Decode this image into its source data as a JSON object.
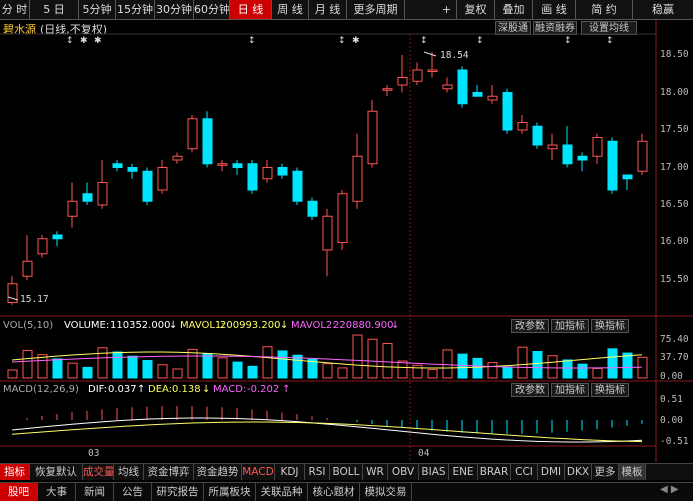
{
  "toolbar": {
    "left": [
      "分 时",
      "5 日",
      "5分钟",
      "15分钟",
      "30分钟",
      "60分钟",
      "日 线",
      "周 线",
      "月 线",
      "更多周期"
    ],
    "active_index": 6,
    "right": [
      "+",
      "复权",
      "叠加",
      "画 线",
      "简 约",
      "稳赢"
    ]
  },
  "header": {
    "stock_name": "碧水源",
    "mode": "(日线,不复权)",
    "tabs": [
      "深股通",
      "融资融券",
      "设置均线"
    ]
  },
  "price_axis": [
    "18.50",
    "18.00",
    "17.50",
    "17.00",
    "16.50",
    "16.00",
    "15.50"
  ],
  "annotations": {
    "high": "18.54",
    "low": "15.17"
  },
  "volume_panel": {
    "label": "VOL(5,10)",
    "volume_label": "VOLUME:",
    "volume": "110352.000",
    "mavol1_label": "MAVOL1:",
    "mavol1": "200993.200",
    "mavol2_label": "MAVOL2:",
    "mavol2": "220880.900",
    "buttons": [
      "改参数",
      "加指标",
      "换指标"
    ],
    "axis": [
      "75.40",
      "37.70",
      "0.00"
    ]
  },
  "macd_panel": {
    "label": "MACD(12,26,9)",
    "dif_label": "DIF:",
    "dif": "0.037",
    "dea_label": "DEA:",
    "dea": "0.138",
    "macd_label": "MACD:",
    "macd": "-0.202",
    "buttons": [
      "改参数",
      "加指标",
      "换指标"
    ],
    "axis": [
      "0.51",
      "0.00",
      "-0.51"
    ],
    "x_labels": [
      "03",
      "04"
    ]
  },
  "indicator_tabs": [
    "指标",
    "恢复默认",
    "成交量",
    "均线",
    "资金博弈",
    "资金趋势",
    "MACD",
    "KDJ",
    "RSI",
    "BOLL",
    "WR",
    "OBV",
    "BIAS",
    "ENE",
    "BRAR",
    "CCI",
    "DMI",
    "DKX",
    "更多",
    "模板"
  ],
  "bottom_nav": [
    "股吧",
    "大事",
    "新闻",
    "公告",
    "研究报告",
    "所属板块",
    "关联品种",
    "核心题材",
    "模拟交易"
  ],
  "colors": {
    "up": "#ff5555",
    "down": "#00e5ff",
    "active": "#cc0000",
    "mavol1": "#ffff66",
    "mavol2": "#ff66ff"
  }
}
